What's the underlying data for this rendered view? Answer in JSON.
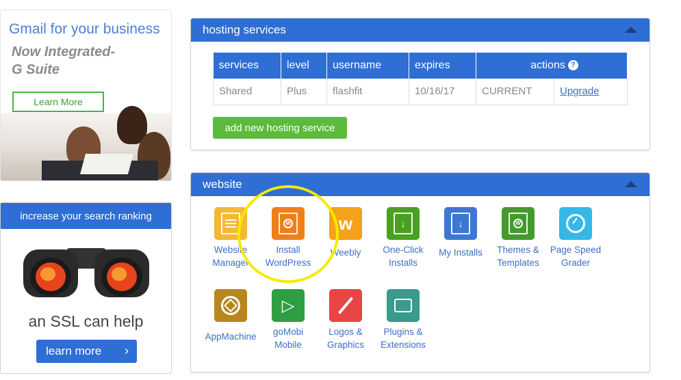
{
  "ads": {
    "gmail": {
      "title": "Gmail for your business",
      "subtitle_line1": "Now Integrated-",
      "subtitle_line2": "G Suite",
      "button": "Learn More"
    },
    "ssl": {
      "header": "increase your search ranking",
      "text": "an SSL can help",
      "button": "learn more"
    }
  },
  "hosting": {
    "title": "hosting services",
    "columns": [
      "services",
      "level",
      "username",
      "expires",
      "actions"
    ],
    "rows": [
      {
        "service": "Shared",
        "level": "Plus",
        "username": "flashfit",
        "expires": "10/16/17",
        "status": "CURRENT",
        "action": "Upgrade"
      }
    ],
    "add_button": "add new hosting service"
  },
  "website": {
    "title": "website",
    "tiles": [
      {
        "line1": "Website",
        "line2": "Manager",
        "color": "#f5b836",
        "icon": "website-manager-icon"
      },
      {
        "line1": "Install",
        "line2": "WordPress",
        "color": "#f07f1a",
        "icon": "wordpress-icon"
      },
      {
        "line1": "Weebly",
        "line2": "",
        "color": "#f5a21a",
        "icon": "weebly-icon"
      },
      {
        "line1": "One-Click",
        "line2": "Installs",
        "color": "#4aa121",
        "icon": "one-click-icon"
      },
      {
        "line1": "My Installs",
        "line2": "",
        "color": "#3e77d2",
        "icon": "my-installs-icon"
      },
      {
        "line1": "Themes &",
        "line2": "Templates",
        "color": "#459a2d",
        "icon": "themes-icon"
      },
      {
        "line1": "Page Speed",
        "line2": "Grader",
        "color": "#35b8e8",
        "icon": "page-speed-icon"
      },
      {
        "line1": "AppMachine",
        "line2": "",
        "color": "#b8861f",
        "icon": "appmachine-icon"
      },
      {
        "line1": "goMobi",
        "line2": "Mobile",
        "color": "#2e9e42",
        "icon": "gomobi-icon"
      },
      {
        "line1": "Logos &",
        "line2": "Graphics",
        "color": "#e84545",
        "icon": "logos-icon"
      },
      {
        "line1": "Plugins &",
        "line2": "Extensions",
        "color": "#3a9a8c",
        "icon": "plugins-icon"
      }
    ]
  }
}
